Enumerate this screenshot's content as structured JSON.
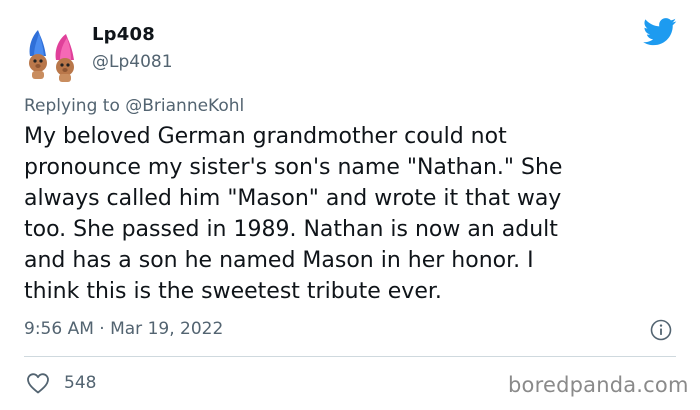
{
  "author": {
    "display_name": "Lp408",
    "handle": "@Lp4081"
  },
  "reply": {
    "prefix": "Replying to",
    "mention": "@BrianneKohl"
  },
  "tweet": {
    "line1": "My beloved German grandmother could not",
    "line2": "pronounce my sister's son's name \"Nathan.\" She",
    "line3": "always called him \"Mason\" and wrote it that way",
    "line4": "too. She passed in 1989. Nathan is now an adult",
    "line5": "and has a son he named Mason in her honor. I",
    "line6": "think this is the sweetest tribute ever."
  },
  "meta": {
    "timestamp": "9:56 AM · Mar 19, 2022"
  },
  "actions": {
    "likes": "548"
  },
  "watermark": "boredpanda.com",
  "icons": {
    "brand": "twitter-bird-icon",
    "info": "info-icon",
    "like": "heart-icon",
    "avatar": "troll-dolls-avatar"
  },
  "colors": {
    "twitter_blue": "#1d9bf0",
    "text_primary": "#0f1419",
    "text_secondary": "#536471",
    "divider": "#cfd9de"
  }
}
